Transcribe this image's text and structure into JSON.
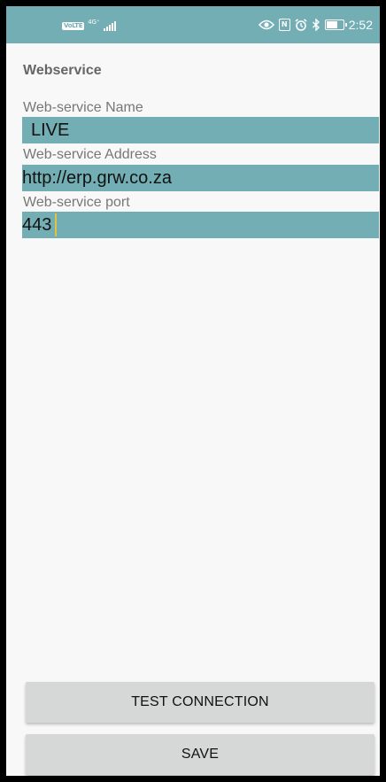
{
  "status_bar": {
    "volte": "VoLTE",
    "network": "4G⁺",
    "time": "2:52",
    "icons": [
      "eye-icon",
      "nfc-icon",
      "alarm-icon",
      "bluetooth-icon",
      "battery-icon"
    ],
    "battery_level": 0.75
  },
  "page": {
    "section_title": "Webservice"
  },
  "fields": {
    "name": {
      "label": "Web-service Name",
      "value": "LIVE"
    },
    "address": {
      "label": "Web-service Address",
      "value": "http://erp.grw.co.za"
    },
    "port": {
      "label": "Web-service port",
      "value": "443"
    }
  },
  "buttons": {
    "test_connection": "TEST CONNECTION",
    "save": "SAVE"
  },
  "colors": {
    "accent": "#72aeb3",
    "background": "#f8f8f8",
    "button": "#d6d7d7",
    "cursor": "#e3c23d"
  }
}
